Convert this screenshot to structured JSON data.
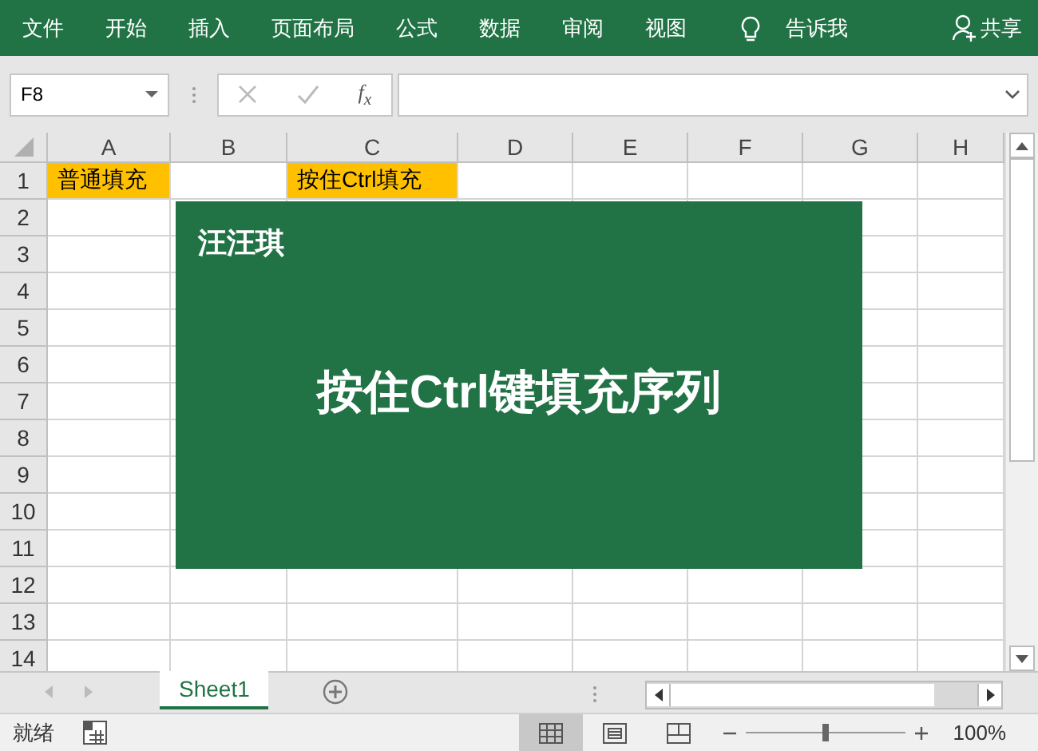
{
  "ribbon": {
    "tabs": [
      {
        "label": "文件"
      },
      {
        "label": "开始"
      },
      {
        "label": "插入"
      },
      {
        "label": "页面布局"
      },
      {
        "label": "公式"
      },
      {
        "label": "数据"
      },
      {
        "label": "审阅"
      },
      {
        "label": "视图"
      }
    ],
    "tell_me": "告诉我",
    "share": "共享"
  },
  "formula_bar": {
    "name_box": "F8",
    "function_label": "f$_{x}$"
  },
  "columns": [
    "A",
    "B",
    "C",
    "D",
    "E",
    "F",
    "G",
    "H"
  ],
  "rows": [
    {
      "header": "1",
      "cells": [
        {
          "text": "普通填充",
          "highlighted": true
        },
        {
          "highlighted": false
        },
        {
          "text": "按住Ctrl填充",
          "highlighted": true
        }
      ]
    },
    {
      "header": "2"
    },
    {
      "header": "3"
    },
    {
      "header": "4"
    },
    {
      "header": "5"
    },
    {
      "header": "6"
    },
    {
      "header": "7"
    },
    {
      "header": "8"
    },
    {
      "header": "9"
    },
    {
      "header": "10"
    },
    {
      "header": "11"
    },
    {
      "header": "12"
    },
    {
      "header": "13"
    },
    {
      "header": "14"
    }
  ],
  "overlay": {
    "author": "汪汪琪",
    "title": "按住Ctrl键填充序列"
  },
  "sheet_tabs": [
    {
      "label": "Sheet1",
      "selected": true
    }
  ],
  "status_bar": {
    "status": "就绪",
    "views": [
      {
        "kind": "normal",
        "selected": true
      },
      {
        "kind": "page-layout",
        "selected": false
      },
      {
        "kind": "page-break",
        "selected": false
      }
    ],
    "zoom": {
      "level": 0.5,
      "reading": "100%"
    }
  }
}
